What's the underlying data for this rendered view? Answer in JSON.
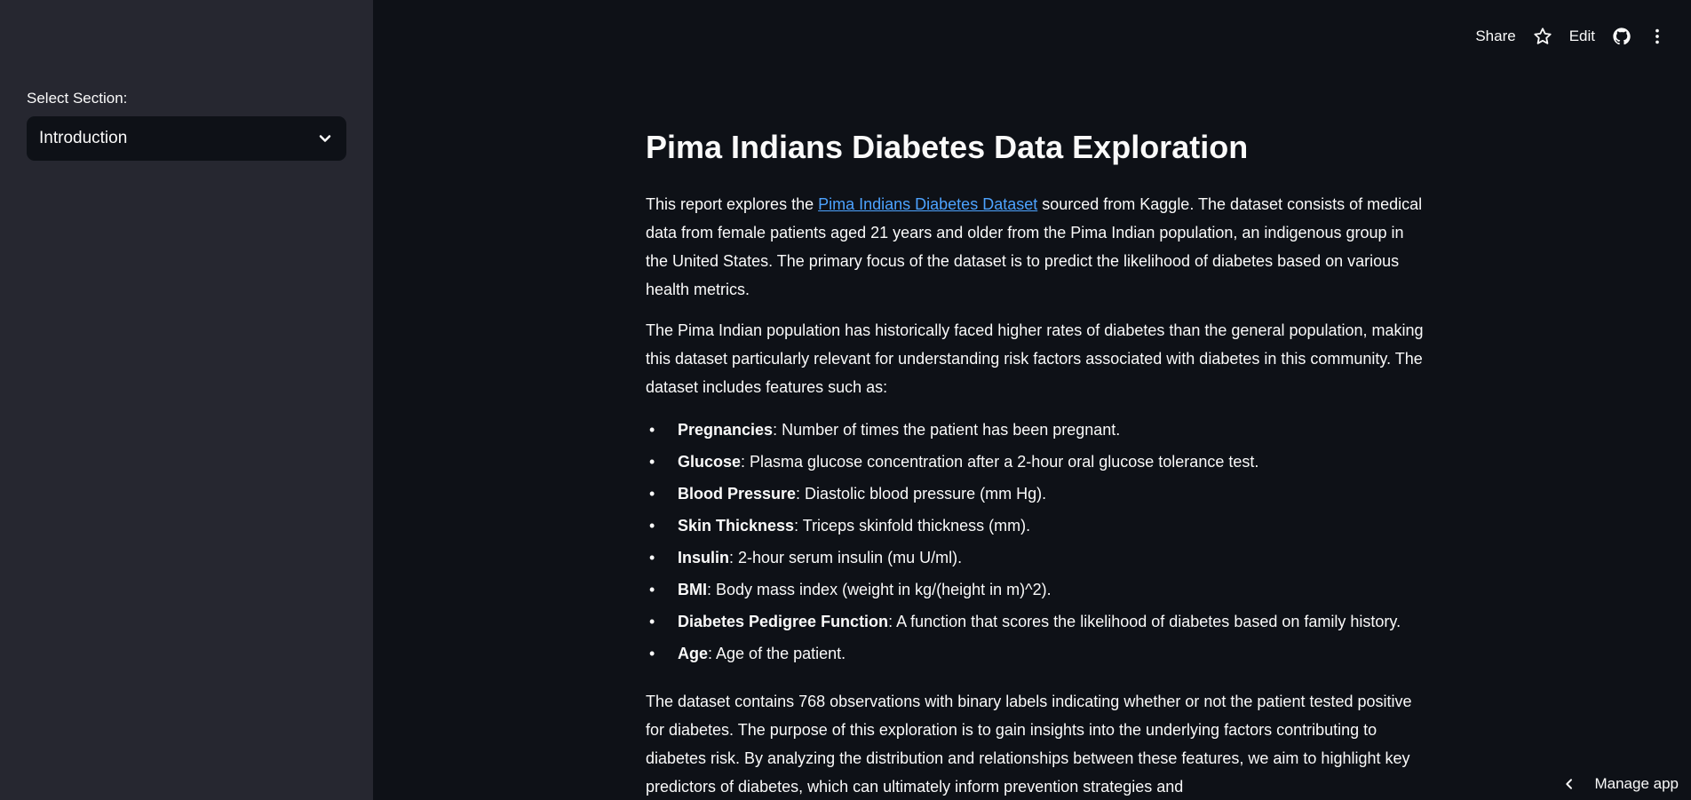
{
  "sidebar": {
    "select_label": "Select Section:",
    "select_value": "Introduction"
  },
  "toolbar": {
    "share_label": "Share",
    "edit_label": "Edit"
  },
  "main": {
    "title": "Pima Indians Diabetes Data Exploration",
    "intro_before_link": "This report explores the ",
    "intro_link": "Pima Indians Diabetes Dataset",
    "intro_after_link": " sourced from Kaggle. The dataset consists of medical data from female patients aged 21 years and older from the Pima Indian population, an indigenous group in the United States. The primary focus of the dataset is to predict the likelihood of diabetes based on various health metrics.",
    "para2": "The Pima Indian population has historically faced higher rates of diabetes than the general population, making this dataset particularly relevant for understanding risk factors associated with diabetes in this community. The dataset includes features such as:",
    "features": [
      {
        "name": "Pregnancies",
        "desc": ": Number of times the patient has been pregnant."
      },
      {
        "name": "Glucose",
        "desc": ": Plasma glucose concentration after a 2-hour oral glucose tolerance test."
      },
      {
        "name": "Blood Pressure",
        "desc": ": Diastolic blood pressure (mm Hg)."
      },
      {
        "name": "Skin Thickness",
        "desc": ": Triceps skinfold thickness (mm)."
      },
      {
        "name": "Insulin",
        "desc": ": 2-hour serum insulin (mu U/ml)."
      },
      {
        "name": "BMI",
        "desc": ": Body mass index (weight in kg/(height in m)^2)."
      },
      {
        "name": "Diabetes Pedigree Function",
        "desc": ": A function that scores the likelihood of diabetes based on family history."
      },
      {
        "name": "Age",
        "desc": ": Age of the patient."
      }
    ],
    "para3": "The dataset contains 768 observations with binary labels indicating whether or not the patient tested positive for diabetes. The purpose of this exploration is to gain insights into the underlying factors contributing to diabetes risk. By analyzing the distribution and relationships between these features, we aim to highlight key predictors of diabetes, which can ultimately inform prevention strategies and"
  },
  "manage_app_label": "Manage app",
  "icons": {
    "chevron": "chevron-down-icon",
    "star": "star-icon",
    "github": "github-icon",
    "more": "kebab-menu-icon",
    "back": "chevron-left-icon"
  },
  "colors": {
    "background": "#0e1117",
    "sidebar": "#262730",
    "link": "#4da3ff",
    "text": "#fafafa"
  }
}
